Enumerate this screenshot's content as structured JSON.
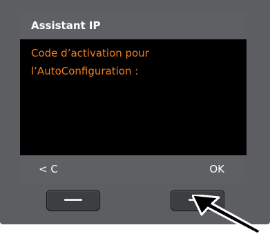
{
  "screen": {
    "title": "Assistant IP",
    "lines": [
      "Code d’activation pour",
      "l’AutoConfiguration :"
    ],
    "softkeys": {
      "left_label": "< C",
      "right_label": "OK"
    }
  },
  "colors": {
    "body_text": "#f07f1e",
    "header_bg": "#5f6063",
    "housing": "#5c5e62"
  },
  "icons": {
    "pointer": "arrow-pointer-icon"
  }
}
